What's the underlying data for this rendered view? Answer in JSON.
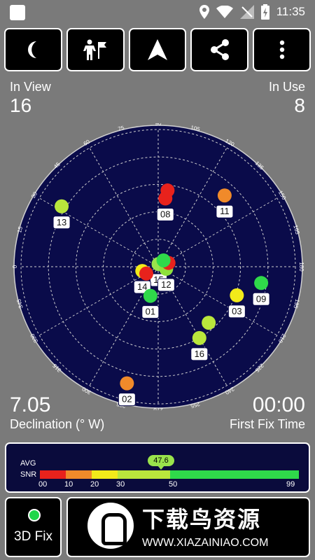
{
  "statusbar": {
    "time": "11:35"
  },
  "toolbar": {
    "buttons": [
      "night-mode",
      "stand-pose",
      "navigation",
      "share",
      "more"
    ]
  },
  "stats": {
    "in_view_label": "In View",
    "in_view_value": "16",
    "in_use_label": "In Use",
    "in_use_value": "8",
    "declination_value": "7.05",
    "declination_label": "Declination (° W)",
    "fix_time_value": "00:00",
    "fix_time_label": "First Fix Time"
  },
  "radar": {
    "azimuth_labels": [
      "90",
      "75",
      "60",
      "45",
      "30",
      "15",
      "0",
      "345",
      "330",
      "315",
      "300",
      "285",
      "270",
      "255",
      "240",
      "225",
      "210",
      "195",
      "180",
      "165",
      "150",
      "135",
      "120",
      "105"
    ],
    "satellites": [
      {
        "label": "11",
        "az": 47,
        "r": 0.71,
        "color": "#f08a2a",
        "badge": true
      },
      {
        "label": "08",
        "az": 84,
        "r": 0.5,
        "color": "#e8221c",
        "badge": true
      },
      {
        "label": "13",
        "az": 148,
        "r": 0.83,
        "color": "#b9e63c",
        "badge": true
      },
      {
        "label": "15",
        "az": 82,
        "r": 0.02,
        "color": "#9ae34c",
        "badge": true
      },
      {
        "label": "12",
        "az": 345,
        "r": 0.06,
        "color": "#8ee13c",
        "badge": true
      },
      {
        "label": "14",
        "az": 195,
        "r": 0.12,
        "color": "#f2ea1a",
        "badge": true
      },
      {
        "label": "09",
        "az": 351,
        "r": 0.76,
        "color": "#2fd94a",
        "badge": true
      },
      {
        "label": "03",
        "az": 340,
        "r": 0.61,
        "color": "#f2ea1a",
        "badge": true
      },
      {
        "label": "01",
        "az": 255,
        "r": 0.22,
        "color": "#2fd94a",
        "badge": true
      },
      {
        "label": "16",
        "az": 300,
        "r": 0.6,
        "color": "#b9e63c",
        "badge": true
      },
      {
        "label": "02",
        "az": 255,
        "r": 0.88,
        "color": "#f08a2a",
        "badge": true
      },
      {
        "label": "",
        "az": 312,
        "r": 0.55,
        "color": "#b9e63c",
        "badge": false
      },
      {
        "label": "",
        "az": 83,
        "r": 0.56,
        "color": "#e8221c",
        "badge": false
      },
      {
        "label": "",
        "az": 20,
        "r": 0.08,
        "color": "#e8221c",
        "badge": false
      },
      {
        "label": "",
        "az": 210,
        "r": 0.1,
        "color": "#e8221c",
        "badge": false
      },
      {
        "label": "",
        "az": 50,
        "r": 0.06,
        "color": "#2fd94a",
        "badge": false
      }
    ]
  },
  "snr": {
    "avg_label": "AVG",
    "snr_label": "SNR",
    "avg_value": "47.6",
    "ticks": [
      "00",
      "10",
      "20",
      "30",
      "50",
      "99"
    ],
    "colors": [
      "#e8221c",
      "#f08a2a",
      "#f2ea1a",
      "#b9e63c",
      "#2fd94a"
    ]
  },
  "fix": {
    "label": "3D Fix",
    "status_color": "#1ed64a"
  },
  "watermark": {
    "brand": "下载鸟资源",
    "url": "WWW.XIAZAINIAO.COM"
  }
}
